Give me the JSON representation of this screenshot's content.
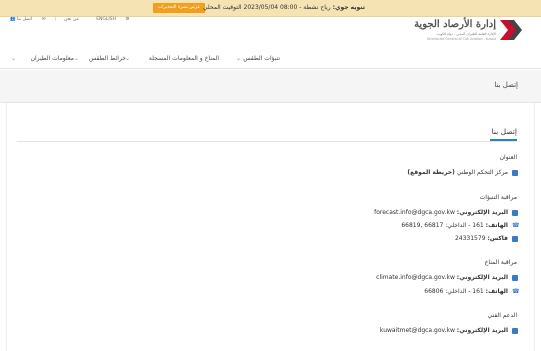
{
  "topbar": {
    "label": "تنويه جوي:",
    "message": "رياح نشطة  - 08:00 2023/05/04 التوقيت المحلي",
    "button": "عرض نشرة التحذيرات"
  },
  "utility": {
    "language": "ENGLISH",
    "contact": "اتصل بنا",
    "about": "من نحن"
  },
  "logo": {
    "title": "إدارة الأرصاد الجوية",
    "subtitle": "الإدارة العامة للطيران المدني - دولة الكويت",
    "subtitle_en": "Directorate General of Civil Aviation - Kuwait"
  },
  "nav": {
    "items": [
      "تنبؤات الطقس",
      "المناخ و المعلومات المسجلة",
      "خرائط الطقس",
      "معلومات الطيران"
    ]
  },
  "page": {
    "title": "إتصل بنا"
  },
  "card": {
    "title": "إتصل بنا",
    "address_heading": "العنوان",
    "address_text": "مركز التحكم الوطني",
    "address_link": "(خريطة الموقع)",
    "forecast_heading": "مراقبة التنبؤات",
    "forecast_email_label": "البريد الإلكتروني:",
    "forecast_email": "forecast.info@dgca.gov.kw",
    "forecast_phone_label": "الهاتف:",
    "forecast_phone": "161 - الداخلي: 66817 ,66819",
    "forecast_fax_label": "فاكس:",
    "forecast_fax": "24331579",
    "climate_heading": "مراقبة المناخ",
    "climate_email_label": "البريد الإلكتروني:",
    "climate_email": "climate.info@dgca.gov.kw",
    "climate_phone_label": "الهاتف:",
    "climate_phone": "161 - الداخلي: 66806",
    "tech_heading": "الدعم الفني",
    "tech_email_label": "البريد الإلكتروني:",
    "tech_email": "kuwaitmet@dgca.gov.kw"
  },
  "colors": {
    "accent": "#2a7fd4",
    "topbar": "#f6e3b4",
    "warn_button": "#f0a01e",
    "logo_red": "#c8102e"
  }
}
